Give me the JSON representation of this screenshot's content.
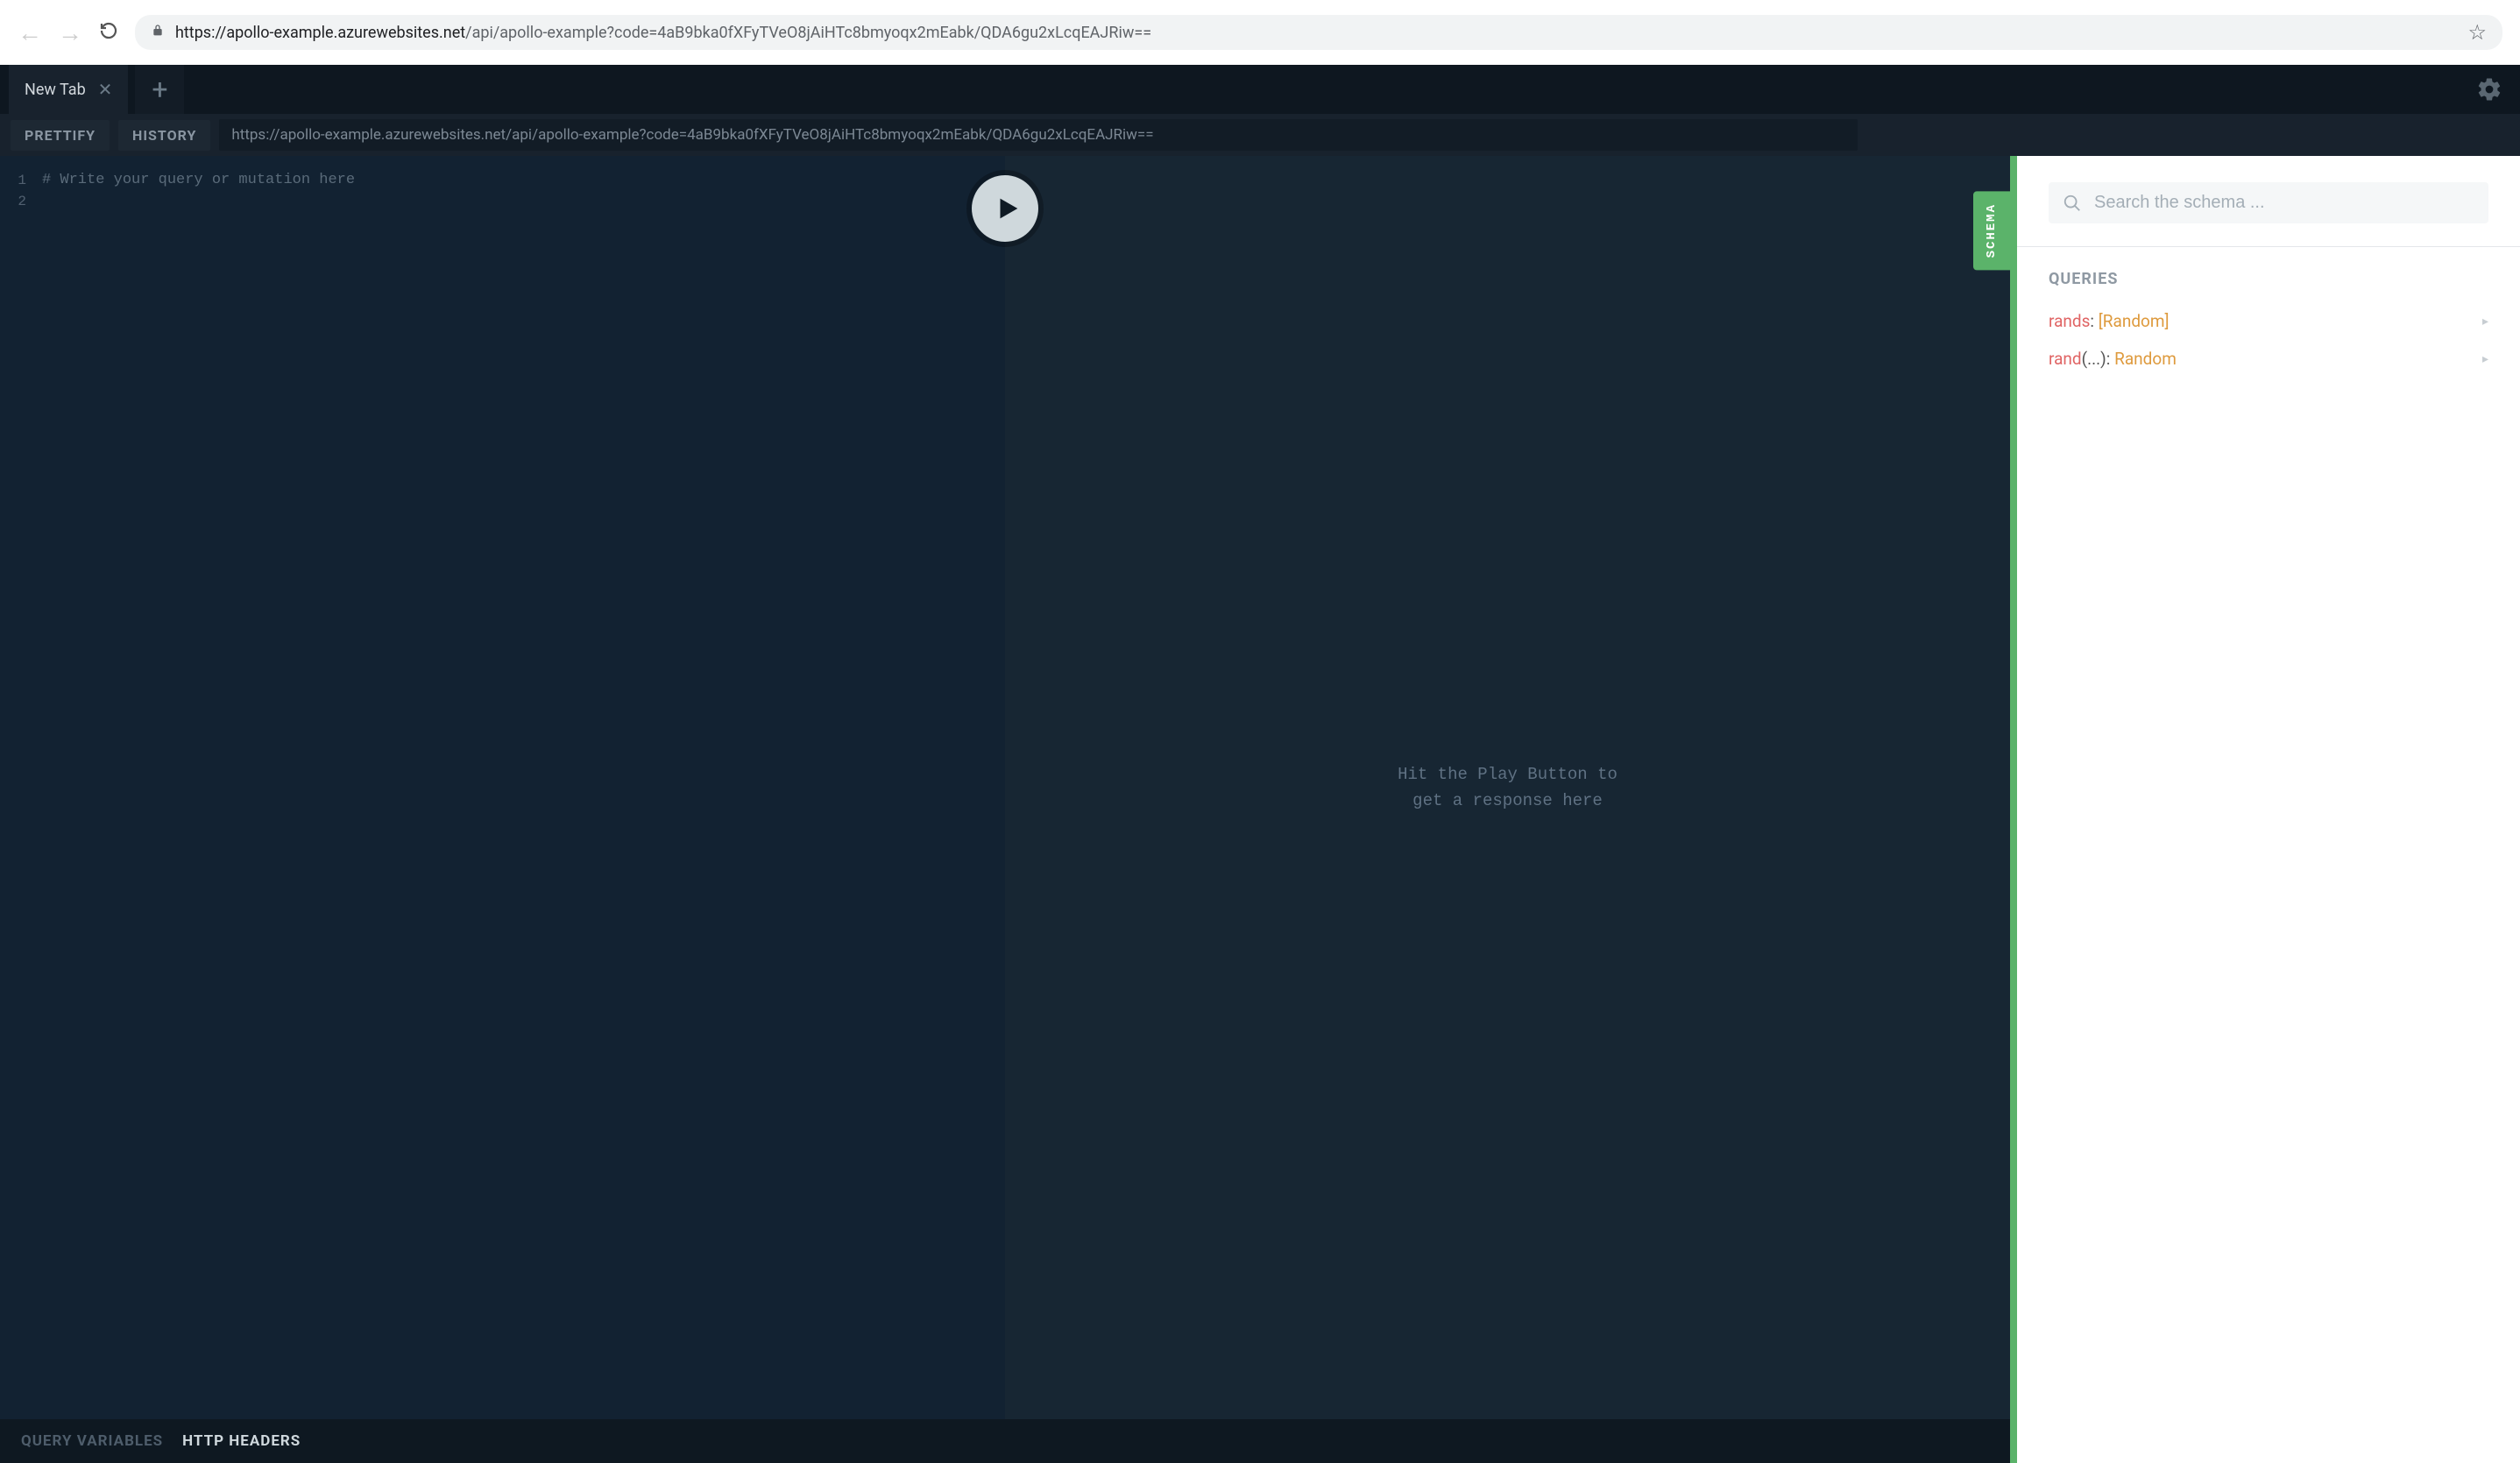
{
  "browser": {
    "url_protocol_host": "https://apollo-example.azurewebsites.net",
    "url_path": "/api/apollo-example?code=4aB9bka0fXFyTVeO8jAiHTc8bmyoqx2mEabk/QDA6gu2xLcqEAJRiw=="
  },
  "tabs": {
    "active": "New Tab"
  },
  "toolbar": {
    "prettify": "PRETTIFY",
    "history": "HISTORY",
    "endpoint": "https://apollo-example.azurewebsites.net/api/apollo-example?code=4aB9bka0fXFyTVeO8jAiHTc8bmyoqx2mEabk/QDA6gu2xLcqEAJRiw=="
  },
  "editor": {
    "line_numbers": [
      "1",
      "2"
    ],
    "placeholder": "# Write your query or mutation here"
  },
  "result_hint_line1": "Hit the Play Button to",
  "result_hint_line2": "get a response here",
  "bottom": {
    "variables": "QUERY VARIABLES",
    "headers": "HTTP HEADERS"
  },
  "schema": {
    "tab_label": "SCHEMA",
    "search_placeholder": "Search the schema ...",
    "heading": "QUERIES",
    "rows": [
      {
        "field": "rands",
        "args": "",
        "type": "[Random]"
      },
      {
        "field": "rand",
        "args": "(...)",
        "type": "Random"
      }
    ]
  }
}
